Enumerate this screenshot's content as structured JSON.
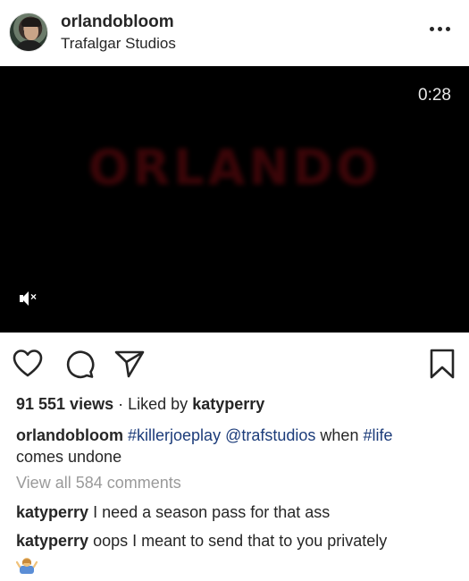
{
  "post": {
    "username": "orlandobloom",
    "location": "Trafalgar Studios",
    "more_icon": "more-horizontal-icon"
  },
  "video": {
    "timer": "0:28",
    "title_text": "ORLANDO",
    "mute_icon": "muted-speaker-icon"
  },
  "actions": {
    "like_icon": "heart-icon",
    "comment_icon": "comment-bubble-icon",
    "share_icon": "paper-plane-icon",
    "save_icon": "bookmark-icon"
  },
  "engagement": {
    "views": "91 551 views",
    "separator": "·",
    "liked_by_prefix": "Liked by",
    "liked_by_user": "katyperry"
  },
  "caption": {
    "username": "orlandobloom",
    "tag1": "#killerjoeplay",
    "tag2": "@trafstudios",
    "text1": "when",
    "tag3": "#life",
    "text2": "comes undone"
  },
  "comments": {
    "view_all": "View all 584 comments",
    "items": [
      {
        "username": "katyperry",
        "text": "I need a season pass for that ass"
      },
      {
        "username": "katyperry",
        "text": "oops I meant to send that to you privately"
      }
    ],
    "emoji": "🤷‍♀️"
  },
  "colors": {
    "text": "#262626",
    "hashtag": "#1c3c7a",
    "muted": "#9a9a9a",
    "video_bg": "#000000"
  }
}
